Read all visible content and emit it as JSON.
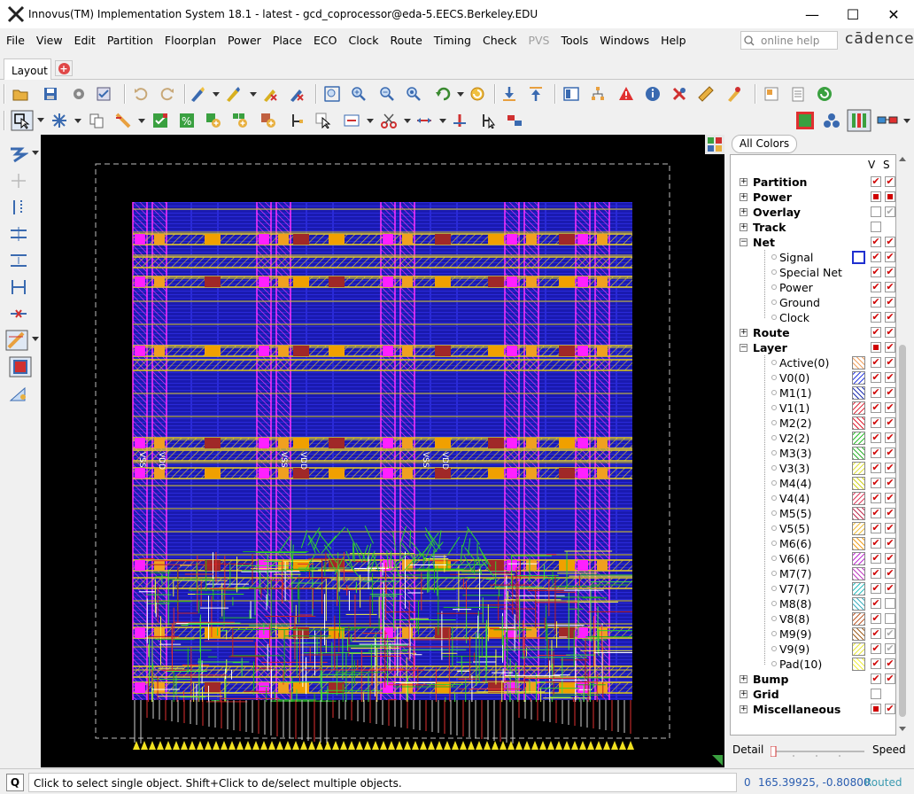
{
  "titlebar": {
    "title": "Innovus(TM) Implementation System 18.1 - latest - gcd_coprocessor@eda-5.EECS.Berkeley.EDU",
    "minimize": "—",
    "maximize": "☐",
    "close": "✕"
  },
  "menu": [
    "File",
    "Edit",
    "View",
    "Partition",
    "Floorplan",
    "Power",
    "Place",
    "ECO",
    "Clock",
    "Route",
    "Timing",
    "Check",
    "PVS",
    "Tools",
    "Windows",
    "Help"
  ],
  "menu_ordered": [
    "File",
    "View",
    "Edit",
    "Partition",
    "Floorplan",
    "Power",
    "Place",
    "ECO",
    "Clock",
    "Route",
    "Timing",
    "Check",
    "PVS",
    "Tools",
    "Windows",
    "Help"
  ],
  "help_search": {
    "placeholder": "online help",
    "icon": "search-icon"
  },
  "brand": "cādence",
  "tab": {
    "label": "Layout",
    "add_icon": "+"
  },
  "canvas": {
    "net_labels": [
      "VSS",
      "VDD",
      "VSS",
      "VDD",
      "VSS",
      "VDD"
    ]
  },
  "panel": {
    "all_colors_label": "All Colors",
    "col_v": "V",
    "col_s": "S",
    "rows": [
      {
        "label": "Partition",
        "cat": true,
        "exp": "+",
        "v": "check",
        "s": "check"
      },
      {
        "label": "Power",
        "cat": true,
        "exp": "+",
        "v": "square",
        "s": "square"
      },
      {
        "label": "Overlay",
        "cat": true,
        "exp": "+",
        "v": "empty",
        "s": "gray"
      },
      {
        "label": "Track",
        "cat": true,
        "exp": "+",
        "v": "empty",
        "s": "none"
      },
      {
        "label": "Net",
        "cat": true,
        "exp": "-",
        "v": "check",
        "s": "check"
      },
      {
        "label": "Signal",
        "cat": false,
        "swatch": "signal",
        "v": "check",
        "s": "check"
      },
      {
        "label": "Special Net",
        "cat": false,
        "v": "check",
        "s": "check"
      },
      {
        "label": "Power",
        "cat": false,
        "v": "check",
        "s": "check"
      },
      {
        "label": "Ground",
        "cat": false,
        "v": "check",
        "s": "check"
      },
      {
        "label": "Clock",
        "cat": false,
        "v": "check",
        "s": "check"
      },
      {
        "label": "Route",
        "cat": true,
        "exp": "+",
        "v": "check",
        "s": "check"
      },
      {
        "label": "Layer",
        "cat": true,
        "exp": "-",
        "v": "square",
        "s": "check"
      },
      {
        "label": "Active(0)",
        "cat": false,
        "swatch": "active",
        "v": "check",
        "s": "check"
      },
      {
        "label": "V0(0)",
        "cat": false,
        "swatch": "v0",
        "v": "check",
        "s": "check"
      },
      {
        "label": "M1(1)",
        "cat": false,
        "swatch": "m1",
        "v": "check",
        "s": "check"
      },
      {
        "label": "V1(1)",
        "cat": false,
        "swatch": "v1",
        "v": "check",
        "s": "check"
      },
      {
        "label": "M2(2)",
        "cat": false,
        "swatch": "m2",
        "v": "check",
        "s": "check"
      },
      {
        "label": "V2(2)",
        "cat": false,
        "swatch": "v2",
        "v": "check",
        "s": "check"
      },
      {
        "label": "M3(3)",
        "cat": false,
        "swatch": "m3",
        "v": "check",
        "s": "check"
      },
      {
        "label": "V3(3)",
        "cat": false,
        "swatch": "v3",
        "v": "check",
        "s": "check"
      },
      {
        "label": "M4(4)",
        "cat": false,
        "swatch": "m4",
        "v": "check",
        "s": "check"
      },
      {
        "label": "V4(4)",
        "cat": false,
        "swatch": "v4",
        "v": "check",
        "s": "check"
      },
      {
        "label": "M5(5)",
        "cat": false,
        "swatch": "m5",
        "v": "check",
        "s": "check"
      },
      {
        "label": "V5(5)",
        "cat": false,
        "swatch": "v5",
        "v": "check",
        "s": "check"
      },
      {
        "label": "M6(6)",
        "cat": false,
        "swatch": "m6",
        "v": "check",
        "s": "check"
      },
      {
        "label": "V6(6)",
        "cat": false,
        "swatch": "v6",
        "v": "check",
        "s": "check"
      },
      {
        "label": "M7(7)",
        "cat": false,
        "swatch": "m7",
        "v": "check",
        "s": "check"
      },
      {
        "label": "V7(7)",
        "cat": false,
        "swatch": "v7",
        "v": "check",
        "s": "check"
      },
      {
        "label": "M8(8)",
        "cat": false,
        "swatch": "m8",
        "v": "check",
        "s": "empty"
      },
      {
        "label": "V8(8)",
        "cat": false,
        "swatch": "v8",
        "v": "check",
        "s": "empty"
      },
      {
        "label": "M9(9)",
        "cat": false,
        "swatch": "m9",
        "v": "check",
        "s": "gray"
      },
      {
        "label": "V9(9)",
        "cat": false,
        "swatch": "v9",
        "v": "check",
        "s": "gray"
      },
      {
        "label": "Pad(10)",
        "cat": false,
        "swatch": "pad",
        "v": "check",
        "s": "check"
      },
      {
        "label": "Bump",
        "cat": true,
        "exp": "+",
        "v": "check",
        "s": "check"
      },
      {
        "label": "Grid",
        "cat": true,
        "exp": "+",
        "v": "empty",
        "s": "none"
      },
      {
        "label": "Miscellaneous",
        "cat": true,
        "exp": "+",
        "v": "square",
        "s": "check"
      }
    ],
    "detail_label": "Detail",
    "speed_label": "Speed"
  },
  "swatch_colors": {
    "signal": "#2030d0",
    "active": "#f0a060",
    "v0": "#3040e0",
    "m1": "#2030b0",
    "v1": "#e03040",
    "m2": "#e02030",
    "v2": "#30c030",
    "m3": "#30b030",
    "v3": "#e0e040",
    "m4": "#d0d020",
    "v4": "#e04060",
    "m5": "#c03050",
    "v5": "#f0c040",
    "m6": "#f0a020",
    "v6": "#c030d0",
    "m7": "#c040c0",
    "v7": "#30c0c0",
    "m8": "#40b0c0",
    "v8": "#c06030",
    "m9": "#a06020",
    "v9": "#e8e840",
    "pad": "#f0f040"
  },
  "status": {
    "quick_key": "Q",
    "message": "Click to select single object. Shift+Click to de/select multiple objects.",
    "zero": "0",
    "coords": "165.39925, -0.80800",
    "state": "Routed"
  }
}
